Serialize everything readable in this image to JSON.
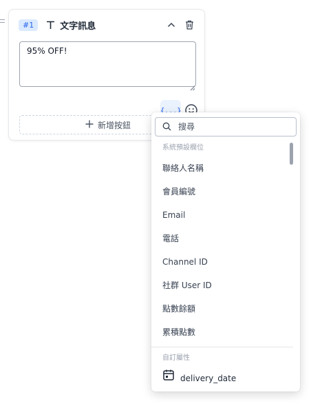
{
  "card": {
    "badge": "#1",
    "title": "文字訊息",
    "message_value": "95% OFF!",
    "variable_button_label": "{...}",
    "add_button_label": "新增按鈕"
  },
  "dropdown": {
    "search_placeholder": "搜尋",
    "system_group_label": "系統預設欄位",
    "system_fields": [
      "聯絡人名稱",
      "會員編號",
      "Email",
      "電話",
      "Channel ID",
      "社群 User ID",
      "點數餘額",
      "累積點數"
    ],
    "custom_group_label": "自訂屬性",
    "custom_fields": [
      "delivery_date"
    ]
  },
  "colors": {
    "accent": "#2563eb",
    "badge_bg": "#dbeafe",
    "variable_button_bg": "#eaf2fe"
  },
  "icons": [
    "drag-handle-icon",
    "text-type-icon",
    "chevron-up-icon",
    "trash-icon",
    "emoji-icon",
    "plus-icon",
    "search-icon",
    "calendar-icon"
  ]
}
